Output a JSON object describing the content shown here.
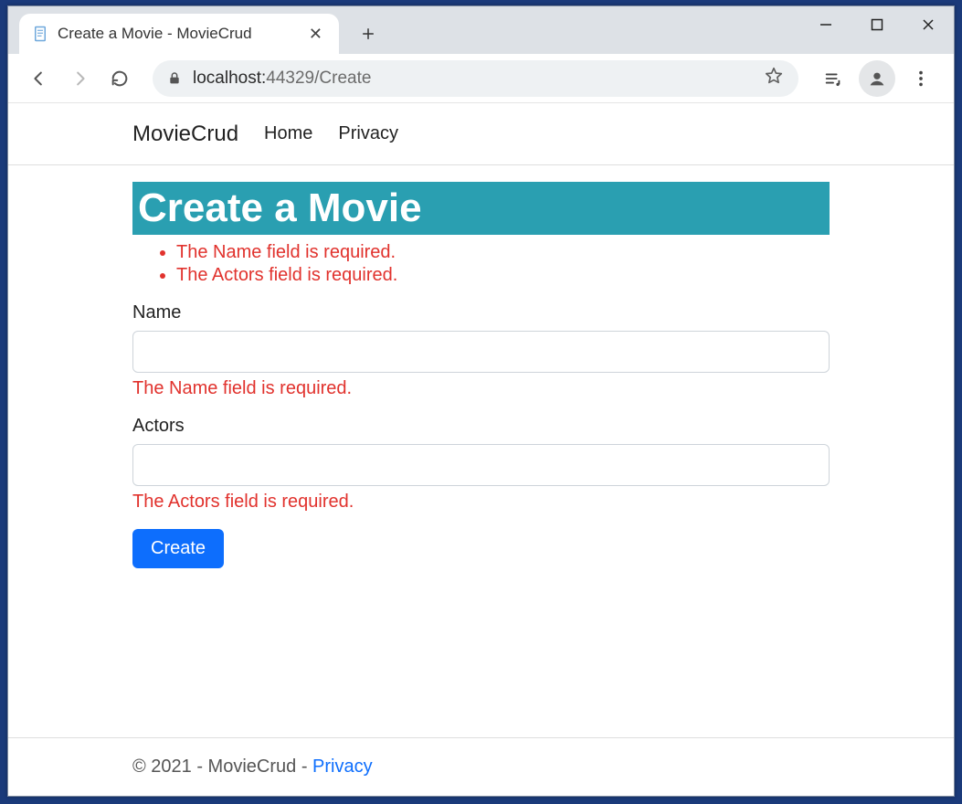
{
  "browser": {
    "tab_title": "Create a Movie - MovieCrud",
    "url_host": "localhost:",
    "url_port_path": "44329/Create"
  },
  "nav": {
    "brand": "MovieCrud",
    "home": "Home",
    "privacy": "Privacy"
  },
  "page": {
    "title": "Create a Movie",
    "summary_errors": {
      "e1": "The Name field is required.",
      "e2": "The Actors field is required."
    },
    "name_label": "Name",
    "name_value": "",
    "name_error": "The Name field is required.",
    "actors_label": "Actors",
    "actors_value": "",
    "actors_error": "The Actors field is required.",
    "submit_label": "Create"
  },
  "footer": {
    "text": "© 2021 - MovieCrud - ",
    "link": "Privacy"
  }
}
